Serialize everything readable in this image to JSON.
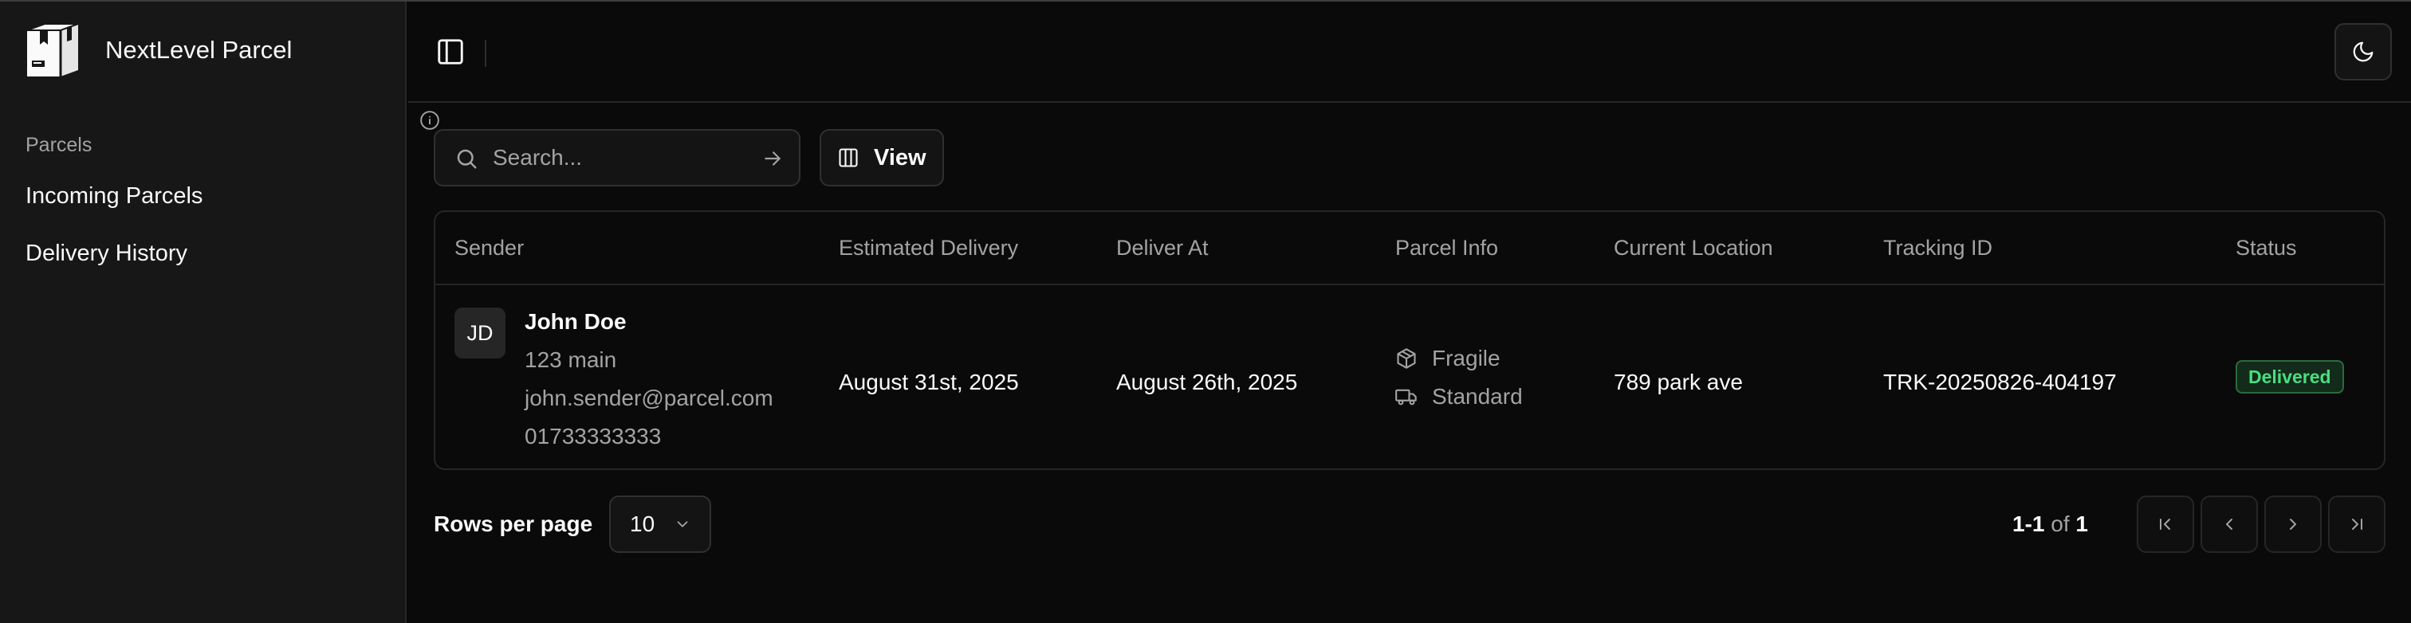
{
  "app": {
    "name": "NextLevel Parcel"
  },
  "sidebar": {
    "group_label": "Parcels",
    "items": [
      {
        "label": "Incoming Parcels"
      },
      {
        "label": "Delivery History"
      }
    ]
  },
  "toolbar": {
    "search_placeholder": "Search...",
    "view_label": "View"
  },
  "table": {
    "columns": [
      "Sender",
      "Estimated Delivery",
      "Deliver At",
      "Parcel Info",
      "Current Location",
      "Tracking ID",
      "Status"
    ],
    "rows": [
      {
        "initials": "JD",
        "sender_name": "John Doe",
        "sender_address": "123 main",
        "sender_email": "john.sender@parcel.com",
        "sender_phone": "01733333333",
        "estimated_delivery": "August 31st, 2025",
        "deliver_at": "August 26th, 2025",
        "parcel_type": "Fragile",
        "shipping_type": "Standard",
        "current_location": "789 park ave",
        "tracking_id": "TRK-20250826-404197",
        "status": "Delivered"
      }
    ]
  },
  "pagination": {
    "rows_per_page_label": "Rows per page",
    "rows_per_page_value": "10",
    "range": "1-1",
    "of_label": "of",
    "total": "1"
  },
  "icons": {
    "brand": "package-box-icon",
    "sidebar_toggle": "panel-left-icon",
    "theme": "moon-icon",
    "info": "info-icon",
    "search": "search-icon",
    "go": "arrow-right-icon",
    "view": "columns-icon",
    "fragile": "package-icon",
    "standard": "truck-icon"
  },
  "colors": {
    "background": "#0a0a0a",
    "sidebar": "#171717",
    "status_delivered": "#4ade80"
  }
}
